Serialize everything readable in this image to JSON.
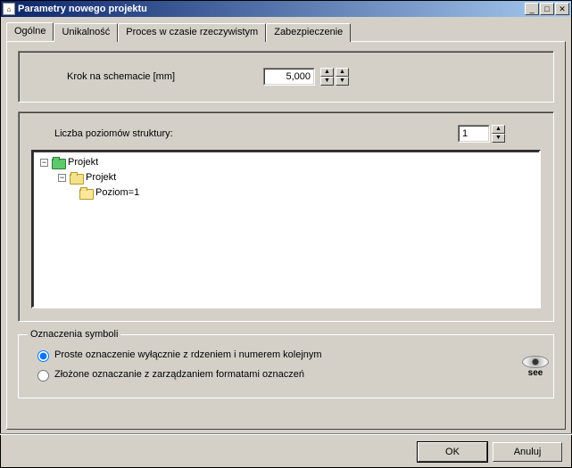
{
  "window": {
    "title": "Parametry nowego projektu"
  },
  "tabs": {
    "t0": "Ogólne",
    "t1": "Unikalność",
    "t2": "Proces w czasie rzeczywistym",
    "t3": "Zabezpieczenie"
  },
  "step": {
    "label": "Krok na schemacie [mm]",
    "value": "5,000"
  },
  "levels": {
    "label": "Liczba poziomów struktury:",
    "value": "1",
    "tree": {
      "root": "Projekt",
      "child": "Projekt",
      "leaf": "Poziom=1"
    }
  },
  "symbols": {
    "legend": "Oznaczenia symboli",
    "opt_simple": "Proste oznaczenie wyłącznie z rdzeniem i numerem kolejnym",
    "opt_complex": "Złożone oznaczanie z zarządzaniem formatami oznaczeń"
  },
  "logo": {
    "text": "see"
  },
  "buttons": {
    "ok": "OK",
    "cancel": "Anuluj"
  }
}
